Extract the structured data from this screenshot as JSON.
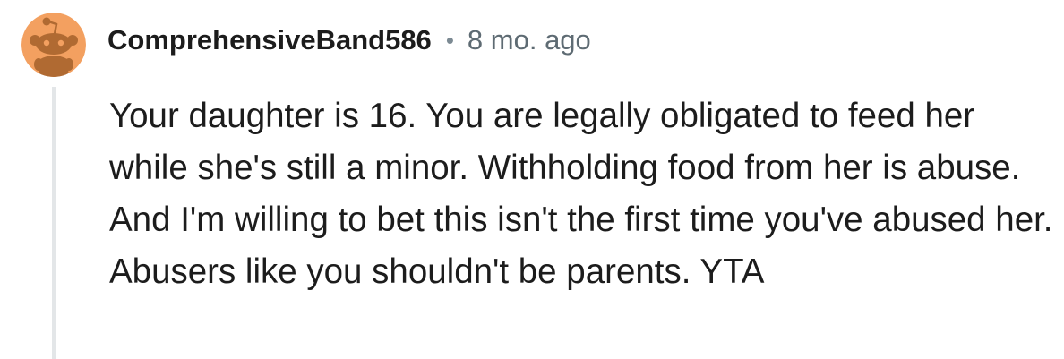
{
  "comment": {
    "author": "ComprehensiveBand586",
    "separator": "•",
    "age": "8 mo. ago",
    "avatar_icon": "snoo-avatar-icon",
    "avatar_bg": "#f3a060",
    "text": "Your daughter is 16. You are legally obligated to feed her while she's still a minor. Withholding food from her is abuse. And I'm willing to bet this isn't the first time you've abused her. Abusers like you shouldn't be parents. YTA"
  }
}
